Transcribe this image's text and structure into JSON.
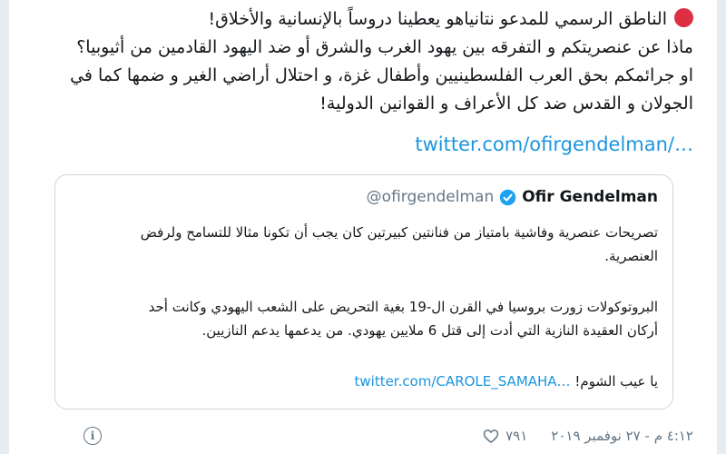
{
  "tweet": {
    "text_lines": [
      "الناطق الرسمي للمدعو نتانياهو يعطينا دروساً بالإنسانية والأخلاق!",
      "ماذا عن عنصريتكم و التفرقه بين يهود الغرب والشرق أو ضد اليهود القادمين من أثيوبيا؟",
      "او جرائمكم بحق العرب الفلسطينيين وأطفال غزة، و احتلال أراضي الغير و ضمها كما في",
      "الجولان و القدس ضد كل الأعراف و القوانين الدولية!"
    ],
    "link": "twitter.com/ofirgendelman/…",
    "accent_colors": {
      "emoji": "#dd2e44",
      "link": "#1b95e0"
    }
  },
  "quote": {
    "name": "Ofir Gendelman",
    "handle": "@ofirgendelman",
    "verified_icon": "verified-badge-icon",
    "paragraph1": [
      "تصريحات عنصرية وفاشية بامتياز من فنانتين كبيرتين كان يجب أن تكونا مثالا للتسامح ولرفض",
      "العنصرية."
    ],
    "paragraph2": [
      "البروتوكولات زورت بروسيا في القرن ال-19 بغية التحريض على الشعب اليهودي وكانت أحد",
      "أركان العقيدة النازية التي أدت إلى قتل 6 ملايين يهودي. من يدعمها يدعم النازيين."
    ],
    "closing_text": "يا عيب الشوم!",
    "closing_link": "twitter.com/CAROLE_SAMAHA…"
  },
  "footer": {
    "date": "٤:١٢ م - ٢٧ نوفمبر ٢٠١٩",
    "likes": "٧٩١",
    "like_icon": "heart-icon",
    "info_icon": "info-icon",
    "info_glyph": "i"
  }
}
